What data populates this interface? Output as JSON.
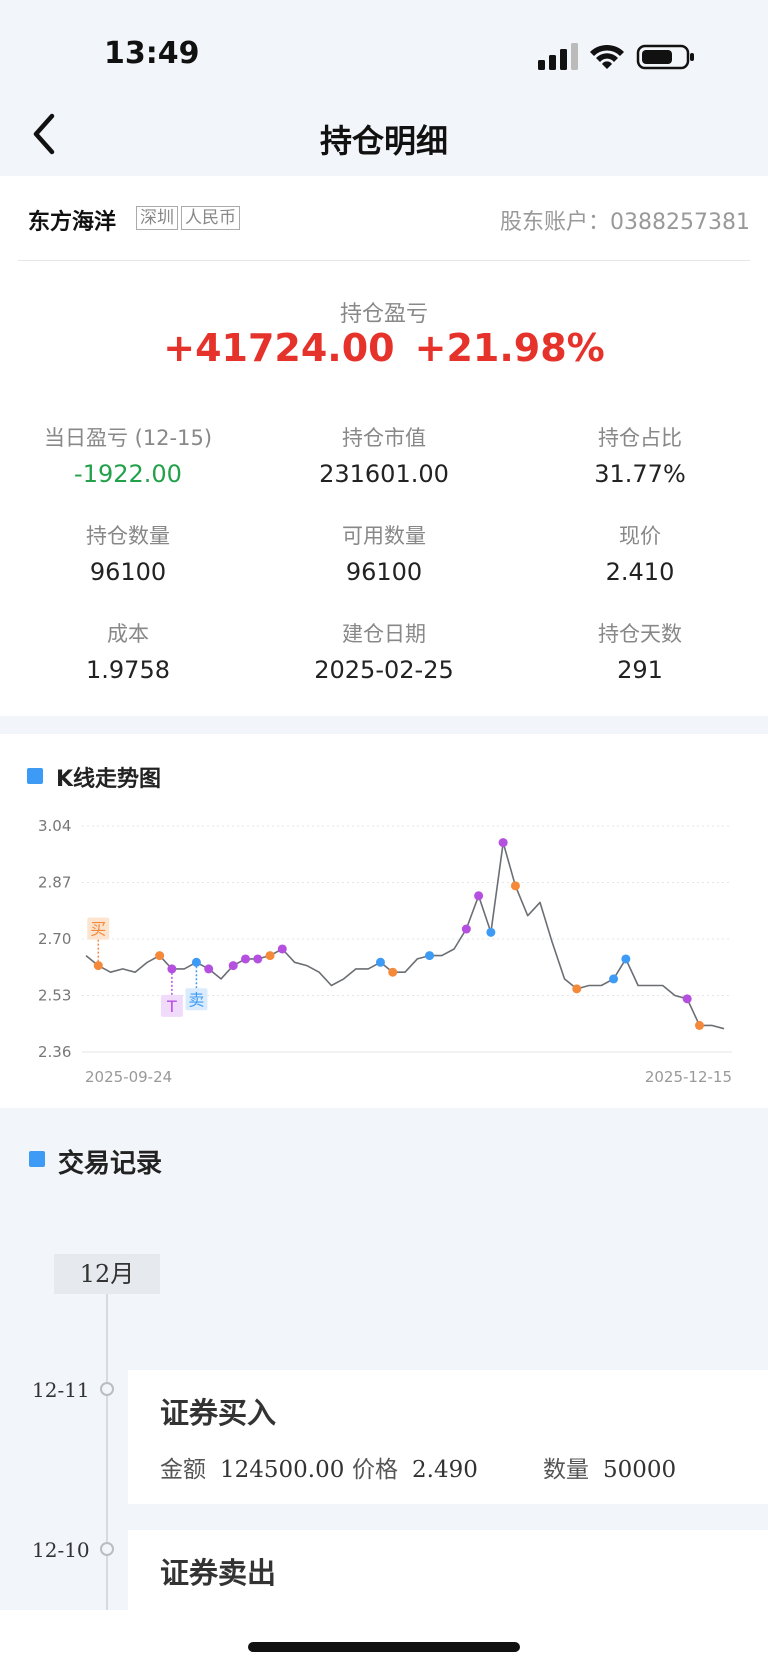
{
  "status": {
    "time": "13:49"
  },
  "nav": {
    "title": "持仓明细"
  },
  "stock": {
    "name": "东方海洋",
    "tags": [
      "深圳",
      "人民币"
    ],
    "account": "股东账户：0388257381"
  },
  "pnl": {
    "label": "持仓盈亏",
    "amount": "+41724.00",
    "percent": "+21.98%"
  },
  "stats": [
    {
      "label": "当日盈亏 (12-15)",
      "value": "-1922.00",
      "tone": "green"
    },
    {
      "label": "持仓市值",
      "value": "231601.00"
    },
    {
      "label": "持仓占比",
      "value": "31.77%"
    },
    {
      "label": "持仓数量",
      "value": "96100"
    },
    {
      "label": "可用数量",
      "value": "96100"
    },
    {
      "label": "现价",
      "value": "2.410"
    },
    {
      "label": "成本",
      "value": "1.9758"
    },
    {
      "label": "建仓日期",
      "value": "2025-02-25"
    },
    {
      "label": "持仓天数",
      "value": "291"
    }
  ],
  "chart_section": {
    "title": "K线走势图"
  },
  "chart_data": {
    "type": "line",
    "y_ticks": [
      "3.04",
      "2.87",
      "2.70",
      "2.53",
      "2.36"
    ],
    "ylim": [
      2.36,
      3.04
    ],
    "x_start_label": "2025-09-24",
    "x_end_label": "2025-12-15",
    "values": [
      2.65,
      2.62,
      2.6,
      2.61,
      2.6,
      2.63,
      2.65,
      2.61,
      2.61,
      2.63,
      2.61,
      2.58,
      2.62,
      2.64,
      2.64,
      2.65,
      2.67,
      2.63,
      2.62,
      2.6,
      2.56,
      2.58,
      2.61,
      2.61,
      2.63,
      2.6,
      2.6,
      2.64,
      2.65,
      2.65,
      2.67,
      2.73,
      2.83,
      2.72,
      2.99,
      2.86,
      2.77,
      2.81,
      2.69,
      2.58,
      2.55,
      2.56,
      2.56,
      2.58,
      2.64,
      2.56,
      2.56,
      2.56,
      2.53,
      2.52,
      2.44,
      2.44,
      2.43
    ],
    "color": "#6b6f74",
    "markers": [
      {
        "i": 1,
        "color": "#f5893a"
      },
      {
        "i": 6,
        "color": "#f5893a"
      },
      {
        "i": 7,
        "color": "#b44fe0"
      },
      {
        "i": 9,
        "color": "#3d9bf5"
      },
      {
        "i": 10,
        "color": "#b44fe0"
      },
      {
        "i": 12,
        "color": "#b44fe0"
      },
      {
        "i": 13,
        "color": "#b44fe0"
      },
      {
        "i": 14,
        "color": "#b44fe0"
      },
      {
        "i": 15,
        "color": "#f5893a"
      },
      {
        "i": 16,
        "color": "#b44fe0"
      },
      {
        "i": 24,
        "color": "#3d9bf5"
      },
      {
        "i": 25,
        "color": "#f5893a"
      },
      {
        "i": 28,
        "color": "#3d9bf5"
      },
      {
        "i": 31,
        "color": "#b44fe0"
      },
      {
        "i": 32,
        "color": "#b44fe0"
      },
      {
        "i": 33,
        "color": "#3d9bf5"
      },
      {
        "i": 34,
        "color": "#b44fe0"
      },
      {
        "i": 35,
        "color": "#f5893a"
      },
      {
        "i": 40,
        "color": "#f5893a"
      },
      {
        "i": 43,
        "color": "#3d9bf5"
      },
      {
        "i": 44,
        "color": "#3d9bf5"
      },
      {
        "i": 49,
        "color": "#b44fe0"
      },
      {
        "i": 50,
        "color": "#f5893a"
      }
    ],
    "annotations": [
      {
        "i": 1,
        "text": "买",
        "color": "#f5893a",
        "bg": "#fde4cf",
        "pos": "above"
      },
      {
        "i": 7,
        "text": "T",
        "color": "#b44fe0",
        "bg": "#f0dcfa",
        "pos": "below"
      },
      {
        "i": 9,
        "text": "卖",
        "color": "#3d9bf5",
        "bg": "#d9ebfd",
        "pos": "below"
      }
    ]
  },
  "trade_section": {
    "title": "交易记录",
    "month": "12月"
  },
  "trades": [
    {
      "date": "12-11",
      "title": "证券买入",
      "amount_label": "金额",
      "amount": "124500.00",
      "price_label": "价格",
      "price": "2.490",
      "qty_label": "数量",
      "qty": "50000"
    },
    {
      "date": "12-10",
      "title": "证券卖出"
    }
  ]
}
